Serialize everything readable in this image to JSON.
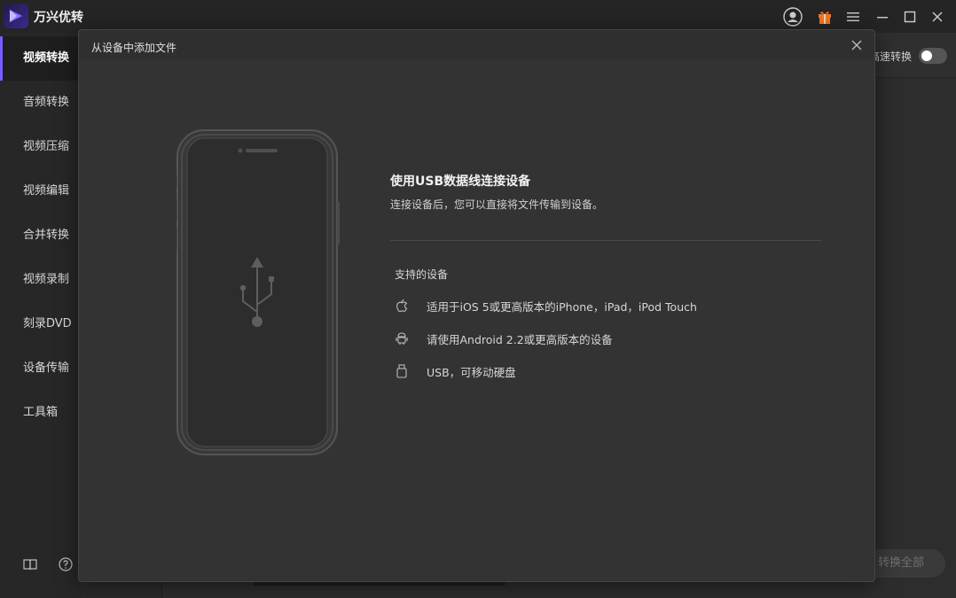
{
  "app": {
    "title": "万兴优转"
  },
  "titlebar_icons": [
    "account-icon",
    "gift-icon",
    "menu-icon",
    "minimize-icon",
    "maximize-icon",
    "close-icon"
  ],
  "sidebar": {
    "items": [
      {
        "label": "视频转换",
        "active": true
      },
      {
        "label": "音频转换"
      },
      {
        "label": "视频压缩"
      },
      {
        "label": "视频编辑"
      },
      {
        "label": "合并转换"
      },
      {
        "label": "视频录制"
      },
      {
        "label": "刻录DVD"
      },
      {
        "label": "设备传输"
      },
      {
        "label": "工具箱"
      }
    ],
    "footer_icons": [
      "book-icon",
      "help-icon"
    ]
  },
  "main": {
    "high_speed_label": "高速转换",
    "high_speed_enabled": false,
    "convert_all_label": "转换全部"
  },
  "modal": {
    "title": "从设备中添加文件",
    "heading": "使用USB数据线连接设备",
    "description": "连接设备后，您可以直接将文件传输到设备。",
    "supported_title": "支持的设备",
    "devices": [
      {
        "icon": "apple-icon",
        "text": "适用于iOS 5或更高版本的iPhone，iPad，iPod Touch"
      },
      {
        "icon": "android-icon",
        "text": "请使用Android 2.2或更高版本的设备"
      },
      {
        "icon": "usb-drive-icon",
        "text": "USB，可移动硬盘"
      }
    ]
  },
  "colors": {
    "accent": "#7a5cff",
    "gift": "#f07a2a"
  }
}
